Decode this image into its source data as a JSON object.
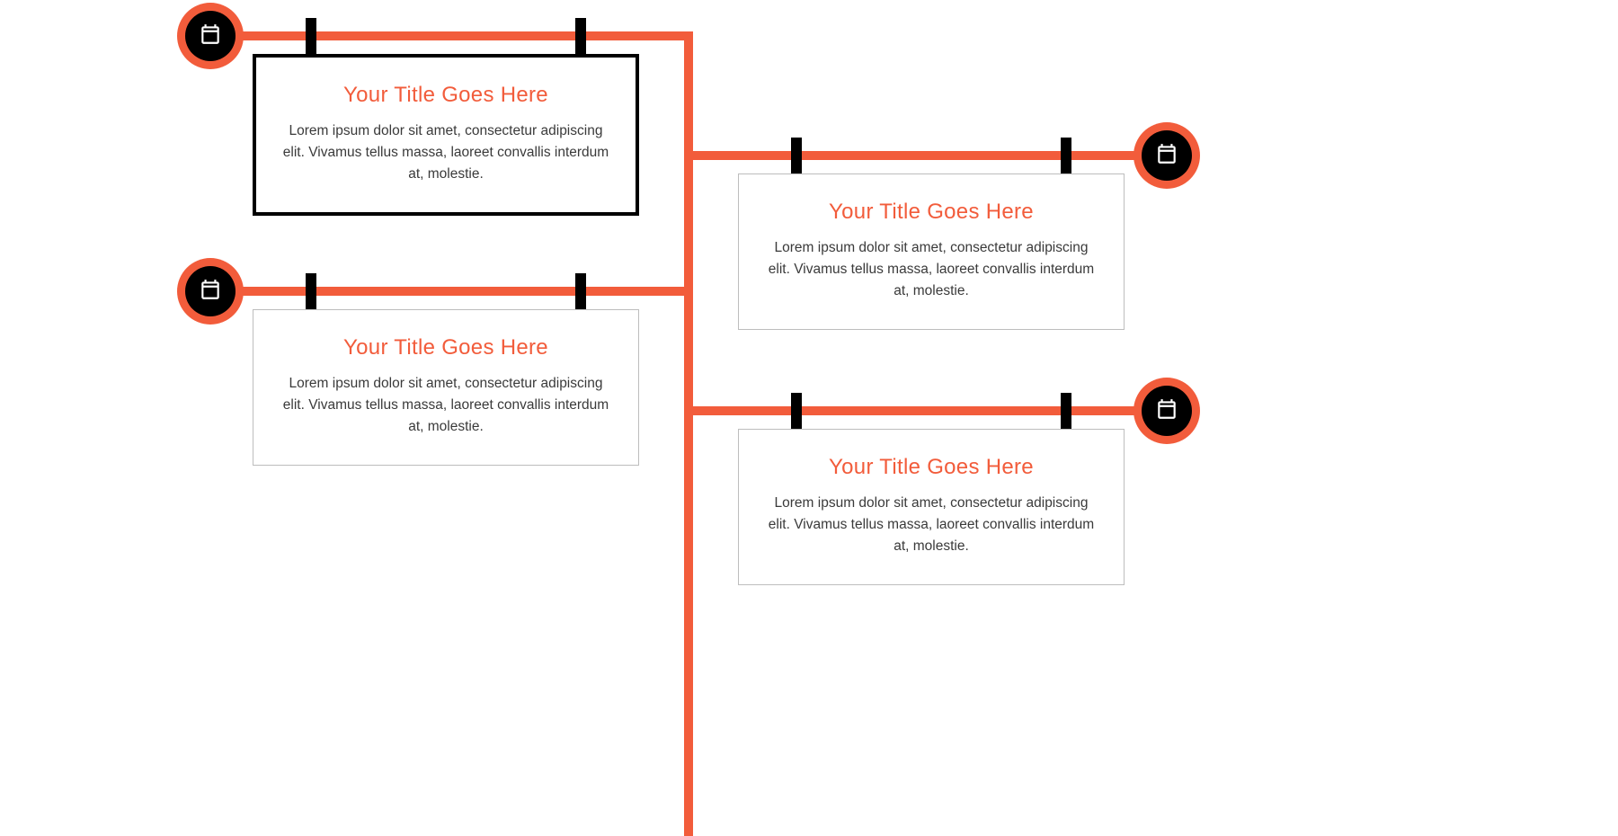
{
  "colors": {
    "accent": "#f25c3b",
    "ink": "#000000",
    "text": "#3a3a3a",
    "card_border": "#bdbdbd"
  },
  "icon": "calendar-icon",
  "items": [
    {
      "side": "left",
      "emphasis": true,
      "title": "Your Title Goes Here",
      "body": "Lorem ipsum dolor sit amet, consectetur adipiscing elit. Vivamus tellus massa, laoreet convallis interdum at, molestie."
    },
    {
      "side": "right",
      "emphasis": false,
      "title": "Your Title Goes Here",
      "body": "Lorem ipsum dolor sit amet, consectetur adipiscing elit. Vivamus tellus massa, laoreet convallis interdum at, molestie."
    },
    {
      "side": "left",
      "emphasis": false,
      "title": "Your Title Goes Here",
      "body": "Lorem ipsum dolor sit amet, consectetur adipiscing elit. Vivamus tellus massa, laoreet convallis interdum at, molestie."
    },
    {
      "side": "right",
      "emphasis": false,
      "title": "Your Title Goes Here",
      "body": "Lorem ipsum dolor sit amet, consectetur adipiscing elit. Vivamus tellus massa, laoreet convallis interdum at, molestie."
    }
  ]
}
